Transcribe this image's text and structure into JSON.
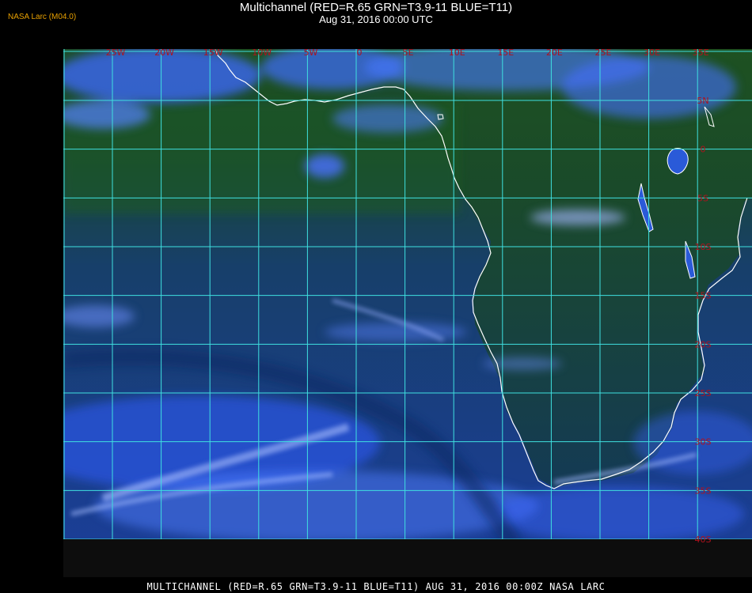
{
  "header": {
    "title": "Multichannel (RED=R.65 GRN=T3.9-11 BLUE=T11)",
    "subtitle": "Aug 31, 2016 00:00 UTC",
    "credit": "NASA Larc (M04.0)"
  },
  "footer": {
    "caption": "MULTICHANNEL (RED=R.65 GRN=T3.9-11 BLUE=T11) AUG 31, 2016 00:00Z   NASA LARC"
  },
  "map": {
    "longitudes": [
      "25W",
      "20W",
      "15W",
      "10W",
      "5W",
      "0",
      "5E",
      "10E",
      "15E",
      "20E",
      "25E",
      "30E",
      "35E"
    ],
    "latitudes": [
      "5N",
      "0",
      "5S",
      "10S",
      "15S",
      "20S",
      "25S",
      "30S",
      "35S",
      "40S"
    ],
    "colors": {
      "grid": "#3fe0e0",
      "label": "#b0121e",
      "coast": "#ffffff",
      "land": "#1e4e1c",
      "ocean": "#12378a",
      "cloud": "#3c6aff"
    }
  }
}
